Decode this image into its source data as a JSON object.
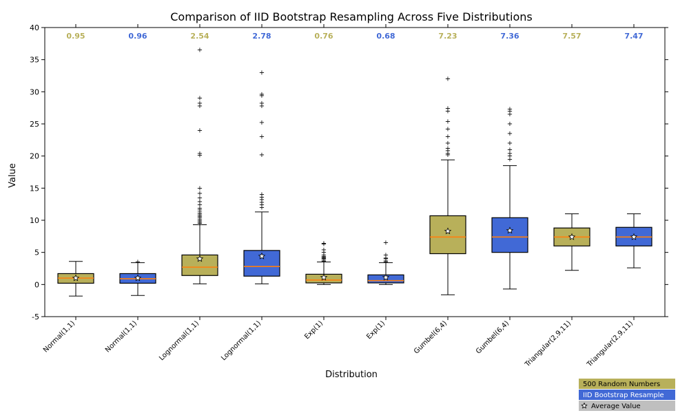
{
  "chart_data": {
    "type": "box",
    "title": "Comparison of IID Bootstrap Resampling Across Five Distributions",
    "xlabel": "Distribution",
    "ylabel": "Value",
    "ylim": [
      -5,
      40
    ],
    "yticks": [
      -5,
      0,
      5,
      10,
      15,
      20,
      25,
      30,
      35,
      40
    ],
    "series_colors": {
      "original": "#b8b05a",
      "bootstrap": "#4169d6"
    },
    "categories": [
      "Normal(1,1)",
      "Normal(1,1)",
      "Lognormal(1,1)",
      "Lognormal(1,1)",
      "Exp(1)",
      "Exp(1)",
      "Gumbel(6,4)",
      "Gumbel(6,4)",
      "Triangular(2,9,11)",
      "Triangular(2,9,11)"
    ],
    "category_kind": [
      "original",
      "bootstrap",
      "original",
      "bootstrap",
      "original",
      "bootstrap",
      "original",
      "bootstrap",
      "original",
      "bootstrap"
    ],
    "top_values": [
      0.95,
      0.96,
      2.54,
      2.78,
      0.76,
      0.68,
      7.23,
      7.36,
      7.57,
      7.47
    ],
    "boxes": [
      {
        "q1": 0.2,
        "med": 1.0,
        "q3": 1.7,
        "wlo": -1.8,
        "whi": 3.6,
        "mean": 1.0,
        "fliers": []
      },
      {
        "q1": 0.2,
        "med": 0.9,
        "q3": 1.7,
        "wlo": -1.7,
        "whi": 3.4,
        "mean": 1.0,
        "fliers": [
          3.5
        ]
      },
      {
        "q1": 1.4,
        "med": 2.7,
        "q3": 4.6,
        "wlo": 0.1,
        "whi": 9.3,
        "mean": 4.0,
        "fliers": [
          9.5,
          9.7,
          9.9,
          10.1,
          10.4,
          10.6,
          10.8,
          11.0,
          11.3,
          11.6,
          11.9,
          12.4,
          12.9,
          13.5,
          14.2,
          15.0,
          20.1,
          20.4,
          24.0,
          27.8,
          28.2,
          29.0,
          36.5
        ]
      },
      {
        "q1": 1.3,
        "med": 2.8,
        "q3": 5.3,
        "wlo": 0.1,
        "whi": 11.3,
        "mean": 4.4,
        "fliers": [
          12.0,
          12.4,
          12.8,
          13.2,
          13.6,
          14.0,
          20.2,
          23.0,
          25.2,
          27.8,
          28.2,
          29.4,
          29.6,
          33.0
        ]
      },
      {
        "q1": 0.25,
        "med": 0.7,
        "q3": 1.6,
        "wlo": 0.0,
        "whi": 3.5,
        "mean": 1.1,
        "fliers": [
          3.6,
          3.8,
          4.0,
          4.1,
          4.2,
          4.4,
          4.6,
          5.0,
          5.4,
          6.3,
          6.4
        ]
      },
      {
        "q1": 0.25,
        "med": 0.6,
        "q3": 1.5,
        "wlo": 0.0,
        "whi": 3.4,
        "mean": 1.1,
        "fliers": [
          3.5,
          3.7,
          4.0,
          4.1,
          4.6,
          6.5
        ]
      },
      {
        "q1": 4.8,
        "med": 7.4,
        "q3": 10.7,
        "wlo": -1.6,
        "whi": 19.4,
        "mean": 8.3,
        "fliers": [
          20.2,
          20.4,
          20.8,
          21.2,
          22.0,
          23.0,
          24.2,
          25.4,
          27.0,
          27.4,
          32.0
        ]
      },
      {
        "q1": 5.0,
        "med": 7.4,
        "q3": 10.4,
        "wlo": -0.7,
        "whi": 18.5,
        "mean": 8.4,
        "fliers": [
          19.5,
          20.0,
          20.4,
          21.0,
          22.0,
          23.5,
          25.0,
          26.5,
          27.0,
          27.3
        ]
      },
      {
        "q1": 6.0,
        "med": 7.4,
        "q3": 8.8,
        "wlo": 2.2,
        "whi": 11.0,
        "mean": 7.4,
        "fliers": []
      },
      {
        "q1": 6.0,
        "med": 7.4,
        "q3": 8.9,
        "wlo": 2.6,
        "whi": 11.0,
        "mean": 7.4,
        "fliers": []
      }
    ],
    "legend": {
      "items": [
        {
          "label": "500 Random Numbers",
          "swatch": "#b8b05a",
          "text_color": "#000"
        },
        {
          "label": "IID Bootstrap Resample",
          "swatch": "#4169d6",
          "text_color": "#fff"
        },
        {
          "label": "Average Value",
          "swatch": "#bfbfbf",
          "text_color": "#000",
          "star": true
        }
      ]
    }
  }
}
